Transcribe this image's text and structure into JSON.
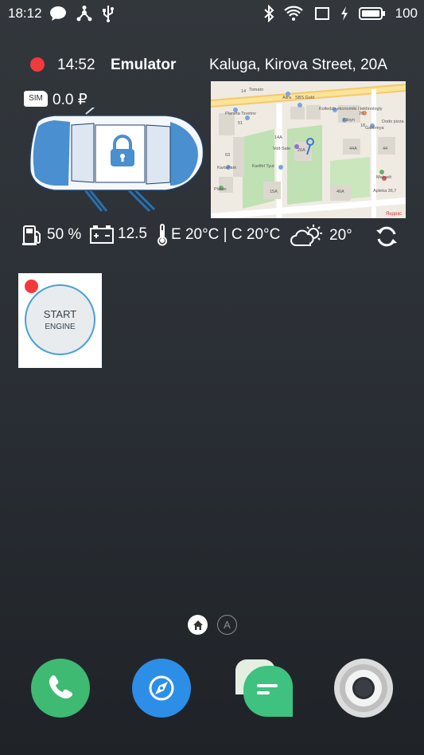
{
  "status_bar": {
    "time": "18:12",
    "left_icons": [
      "chat-bubble-icon",
      "share-nodes-icon",
      "usb-icon"
    ],
    "right_icons": [
      "bluetooth-icon",
      "wifi-icon",
      "screen-cast-icon",
      "charging-icon",
      "battery-icon"
    ],
    "battery_percent": "100"
  },
  "car_widget": {
    "time": "14:52",
    "name": "Emulator",
    "address": "Kaluga, Kirova Street, 20A",
    "sim_label": "SIM",
    "balance": "0.0 ₽",
    "lock_state": "locked",
    "map": {
      "labels": [
        "14",
        "Tomato",
        "Alira",
        "SBS Gold",
        "51",
        "Planeta Tsvetov",
        "Kolledzh ekonomiki i tekhnologiy",
        "20",
        "Dodo pizza",
        "18",
        "Biloyn",
        "Gallereya",
        "14A",
        "Volt-Sale",
        "20A",
        "44A",
        "44",
        "Kartfel Tyut",
        "Makselt",
        "53",
        "KartsPark",
        "Apteka 36,7",
        "Platan",
        "15A",
        "46A",
        "Яндекс"
      ]
    },
    "metrics": {
      "fuel": "50 %",
      "battery_voltage": "12.5",
      "temperature": "E 20°C | C 20°C",
      "weather": "20°"
    },
    "colors": {
      "indicator": "#f2393b",
      "car_blue": "#4a8fd0"
    }
  },
  "start_widget": {
    "line1": "START",
    "line2": "ENGINE"
  },
  "pager": {
    "home_icon": "home-icon",
    "second_page": "A"
  },
  "dock": {
    "apps": [
      {
        "name": "phone-app",
        "icon": "phone-icon",
        "color": "#3fba72"
      },
      {
        "name": "browser-app",
        "icon": "compass-icon",
        "color": "#2d8ee8"
      },
      {
        "name": "messages-app",
        "icon": "message-icon",
        "color": "#3fc17f"
      },
      {
        "name": "camera-app",
        "icon": "camera-icon",
        "color": "#d9d9d9"
      }
    ]
  }
}
